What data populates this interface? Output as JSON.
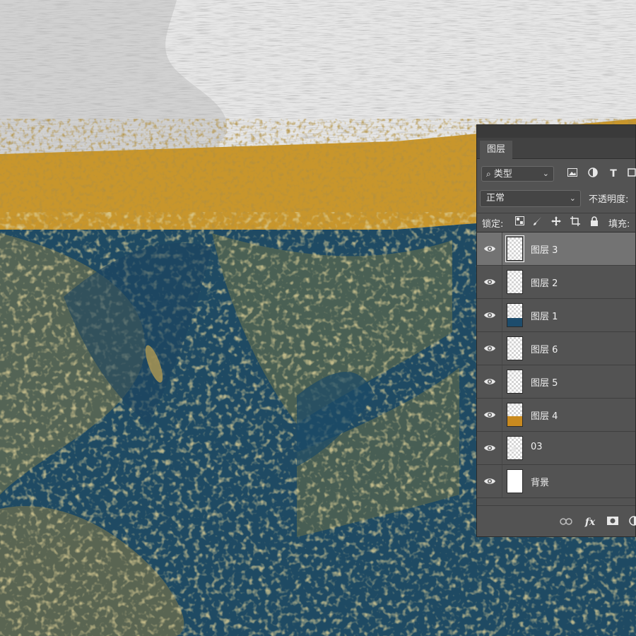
{
  "panel": {
    "tab_label": "图层",
    "filter": {
      "label": "类型",
      "search_icon": "search-icon",
      "chevron": "⌄"
    },
    "filter_icons": [
      "image-filter-icon",
      "adjustment-filter-icon",
      "type-filter-icon"
    ],
    "type_glyph": "T",
    "blend_mode": "正常",
    "opacity_label": "不透明度:",
    "lock_label": "锁定:",
    "lock_icons": [
      "lock-transparent-icon",
      "lock-image-icon",
      "lock-position-icon",
      "lock-artboard-icon",
      "lock-all-icon"
    ],
    "fill_label": "填充:",
    "footer_icons": [
      "link-layers-icon",
      "fx-icon",
      "layer-mask-icon",
      "adjustment-layer-icon"
    ],
    "fx_label": "fx"
  },
  "layers": [
    {
      "name": "图层 3",
      "selected": true,
      "thumb": "transparent"
    },
    {
      "name": "图层 2",
      "selected": false,
      "thumb": "transparent"
    },
    {
      "name": "图层 1",
      "selected": false,
      "thumb": "blue"
    },
    {
      "name": "图层 6",
      "selected": false,
      "thumb": "transparent"
    },
    {
      "name": "图层 5",
      "selected": false,
      "thumb": "transparent"
    },
    {
      "name": "图层 4",
      "selected": false,
      "thumb": "gold"
    },
    {
      "name": "03",
      "selected": false,
      "thumb": "speck"
    },
    {
      "name": "背景",
      "selected": false,
      "thumb": "white"
    }
  ],
  "colors": {
    "paper": "#e4e4e4",
    "gold": "#c8962c",
    "navy": "#1f4a63",
    "panel_bg": "#535353",
    "selected_row": "#737373"
  }
}
